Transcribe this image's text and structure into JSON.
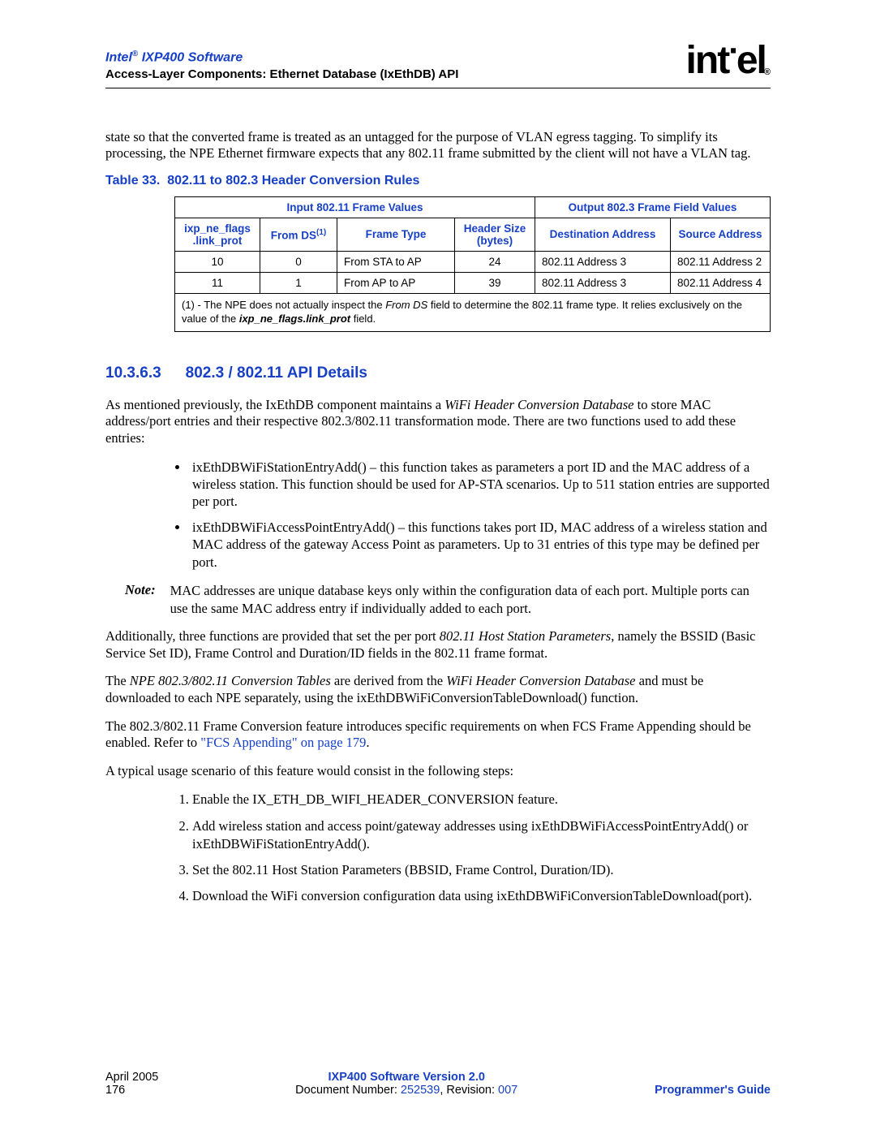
{
  "header": {
    "product": "Intel",
    "product_suffix": " IXP400 Software",
    "subtitle": "Access-Layer Components: Ethernet Database (IxEthDB) API",
    "logo_text": "intel"
  },
  "intro_para": "state so that the converted frame is treated as an untagged for the purpose of VLAN egress tagging. To simplify its processing, the NPE Ethernet firmware expects that any 802.11 frame submitted by the client will not have a VLAN tag.",
  "table": {
    "caption_prefix": "Table 33.",
    "caption_title": "802.11 to 802.3 Header Conversion Rules",
    "group_headers": [
      "Input 802.11 Frame Values",
      "Output 802.3 Frame Field Values"
    ],
    "col_headers": {
      "c1a": "ixp_ne_flags",
      "c1b": ".link_prot",
      "c2": "From DS",
      "c2_sup": "(1)",
      "c3": "Frame Type",
      "c4a": "Header Size",
      "c4b": "(bytes)",
      "c5": "Destination Address",
      "c6": "Source Address"
    },
    "rows": [
      {
        "c1": "10",
        "c2": "0",
        "c3": "From STA to AP",
        "c4": "24",
        "c5": "802.11 Address 3",
        "c6": "802.11 Address 2"
      },
      {
        "c1": "11",
        "c2": "1",
        "c3": "From AP to AP",
        "c4": "39",
        "c5": "802.11 Address 3",
        "c6": "802.11 Address 4"
      }
    ],
    "footnote_a": "(1) - The NPE does not actually inspect the ",
    "footnote_i1": "From DS",
    "footnote_b": " field to determine the 802.11 frame type.  It relies exclusively on the value of the ",
    "footnote_i2": "ixp_ne_flags.link_prot",
    "footnote_c": " field."
  },
  "section": {
    "number": "10.3.6.3",
    "title": "802.3  /  802.11 API Details"
  },
  "para_a1": "As mentioned previously, the IxEthDB component maintains a ",
  "para_a_i": "WiFi Header Conversion Database",
  "para_a2": " to store MAC address/port entries and their respective 802.3/802.11 transformation mode. There are two functions used to add these entries:",
  "bullets": [
    "ixEthDBWiFiStationEntryAdd() – this function takes as parameters a port ID and the MAC address of a wireless station. This function should be used for AP-STA scenarios. Up to 511 station entries are supported per port.",
    "ixEthDBWiFiAccessPointEntryAdd() – this functions takes port ID, MAC address of a wireless station and MAC address of the gateway Access Point as parameters. Up to 31 entries of this type may be defined per port."
  ],
  "note_label": "Note:",
  "note_text": "MAC addresses are unique database keys only within the configuration data of each port. Multiple ports can use the same MAC address entry if individually added to each port.",
  "para_b1": "Additionally, three functions are provided that set the per port ",
  "para_b_i": "802.11 Host Station Parameters",
  "para_b2": ", namely the BSSID (Basic Service Set ID), Frame Control and Duration/ID fields in the 802.11 frame format.",
  "para_c1": "The ",
  "para_c_i1": "NPE 802.3/802.11 Conversion Tables",
  "para_c2": " are derived from the ",
  "para_c_i2": "WiFi Header Conversion Database",
  "para_c3": " and must be downloaded to each NPE separately, using the ixEthDBWiFiConversionTableDownload() function.",
  "para_d1": "The 802.3/802.11 Frame Conversion feature introduces specific requirements on when FCS Frame Appending should be enabled. Refer to ",
  "para_d_link": "\"FCS Appending\" on page 179",
  "para_d2": ".",
  "para_e": "A typical usage scenario of this feature would consist in the following steps:",
  "steps": [
    "Enable the IX_ETH_DB_WIFI_HEADER_CONVERSION feature.",
    "Add wireless station and access point/gateway addresses using ixEthDBWiFiAccessPointEntryAdd() or ixEthDBWiFiStationEntryAdd().",
    "Set the 802.11 Host Station Parameters (BBSID, Frame Control, Duration/ID).",
    "Download the WiFi conversion configuration data using ixEthDBWiFiConversionTableDownload(port)."
  ],
  "footer": {
    "date": "April 2005",
    "page": "176",
    "center_bold": "IXP400 Software Version 2.0",
    "doc_prefix": "Document Number: ",
    "doc_num": "252539",
    "doc_suffix": ", Revision: ",
    "doc_rev": "007",
    "right": "Programmer's Guide"
  }
}
